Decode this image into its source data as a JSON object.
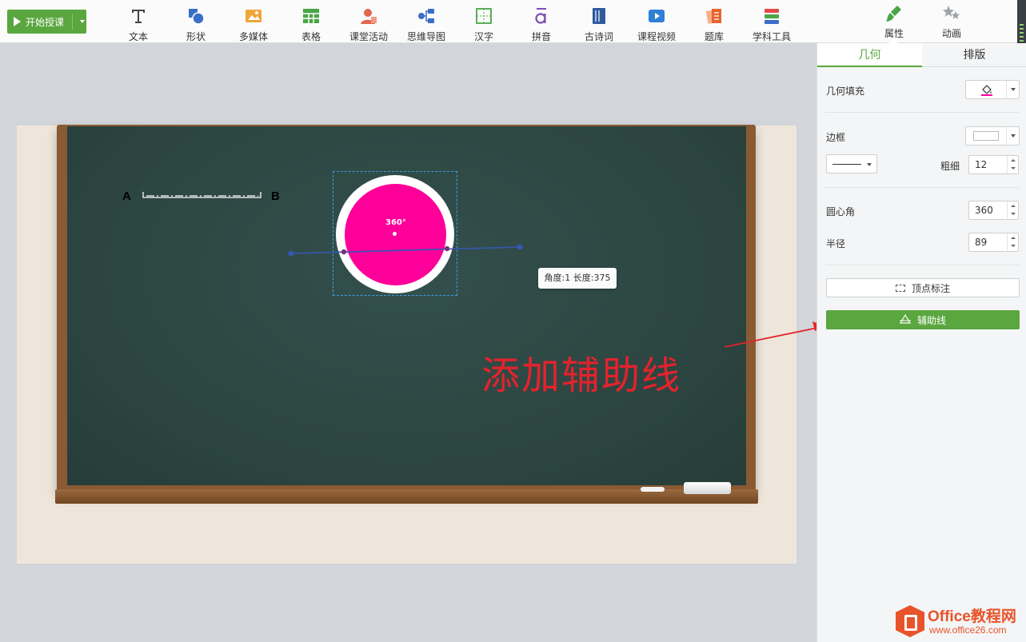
{
  "toolbar": {
    "start_label": "开始授课",
    "tools": [
      {
        "label": "文本",
        "icon": "text-icon"
      },
      {
        "label": "形状",
        "icon": "shape-icon"
      },
      {
        "label": "多媒体",
        "icon": "media-icon"
      },
      {
        "label": "表格",
        "icon": "table-icon"
      },
      {
        "label": "课堂活动",
        "icon": "activity-icon"
      },
      {
        "label": "思维导图",
        "icon": "mindmap-icon"
      },
      {
        "label": "汉字",
        "icon": "hanzi-icon"
      },
      {
        "label": "拼音",
        "icon": "pinyin-icon"
      },
      {
        "label": "古诗词",
        "icon": "poem-icon"
      },
      {
        "label": "课程视频",
        "icon": "video-icon"
      },
      {
        "label": "题库",
        "icon": "question-bank-icon"
      },
      {
        "label": "学科工具",
        "icon": "subject-tools-icon"
      }
    ],
    "right_tabs": [
      {
        "label": "属性",
        "icon": "brush-icon",
        "active": true
      },
      {
        "label": "动画",
        "icon": "stars-icon",
        "active": false
      }
    ],
    "accent_color": "#5aa63f"
  },
  "canvas": {
    "point_a": "A",
    "point_b": "B",
    "angle_label": "360°",
    "tooltip": "角度:1 长度:375",
    "annotation": "添加辅助线",
    "fill_color": "#fe0099",
    "board_color": "#2b4440",
    "annotation_color": "#e3232c"
  },
  "panel": {
    "tabs": [
      {
        "label": "几何",
        "active": true
      },
      {
        "label": "排版",
        "active": false
      }
    ],
    "fill_label": "几何填充",
    "border_label": "边框",
    "thickness_label": "粗细",
    "thickness_value": "12",
    "central_angle_label": "圆心角",
    "central_angle_value": "360",
    "radius_label": "半径",
    "radius_value": "89",
    "vertex_button": "顶点标注",
    "guide_button": "辅助线"
  },
  "watermark": {
    "line1": "Office教程网",
    "line2": "www.office26.com"
  }
}
